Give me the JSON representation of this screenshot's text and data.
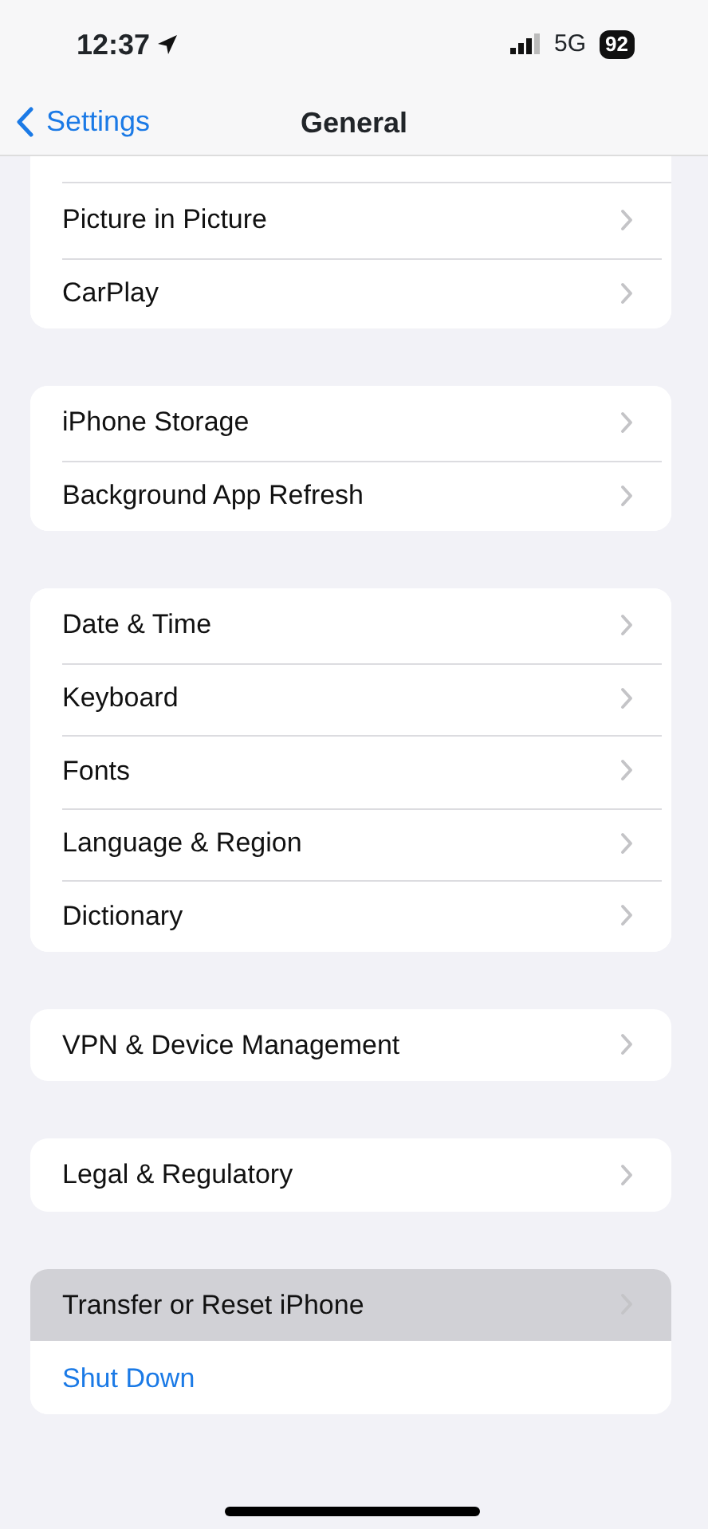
{
  "status_bar": {
    "time": "12:37",
    "network": "5G",
    "battery": "92"
  },
  "nav": {
    "back": "Settings",
    "title": "General"
  },
  "groups": [
    {
      "clipped_top": true,
      "rows": [
        {
          "label": "Picture in Picture",
          "kind": "link",
          "selected": false
        },
        {
          "label": "CarPlay",
          "kind": "link",
          "selected": false
        }
      ]
    },
    {
      "clipped_top": false,
      "rows": [
        {
          "label": "iPhone Storage",
          "kind": "link",
          "selected": false
        },
        {
          "label": "Background App Refresh",
          "kind": "link",
          "selected": false
        }
      ]
    },
    {
      "clipped_top": false,
      "rows": [
        {
          "label": "Date & Time",
          "kind": "link",
          "selected": false
        },
        {
          "label": "Keyboard",
          "kind": "link",
          "selected": false
        },
        {
          "label": "Fonts",
          "kind": "link",
          "selected": false
        },
        {
          "label": "Language & Region",
          "kind": "link",
          "selected": false
        },
        {
          "label": "Dictionary",
          "kind": "link",
          "selected": false
        }
      ]
    },
    {
      "clipped_top": false,
      "rows": [
        {
          "label": "VPN & Device Management",
          "kind": "link",
          "selected": false
        }
      ]
    },
    {
      "clipped_top": false,
      "rows": [
        {
          "label": "Legal & Regulatory",
          "kind": "link",
          "selected": false
        }
      ]
    },
    {
      "clipped_top": false,
      "rows": [
        {
          "label": "Transfer or Reset iPhone",
          "kind": "link",
          "selected": true
        },
        {
          "label": "Shut Down",
          "kind": "action",
          "selected": false
        }
      ]
    }
  ]
}
